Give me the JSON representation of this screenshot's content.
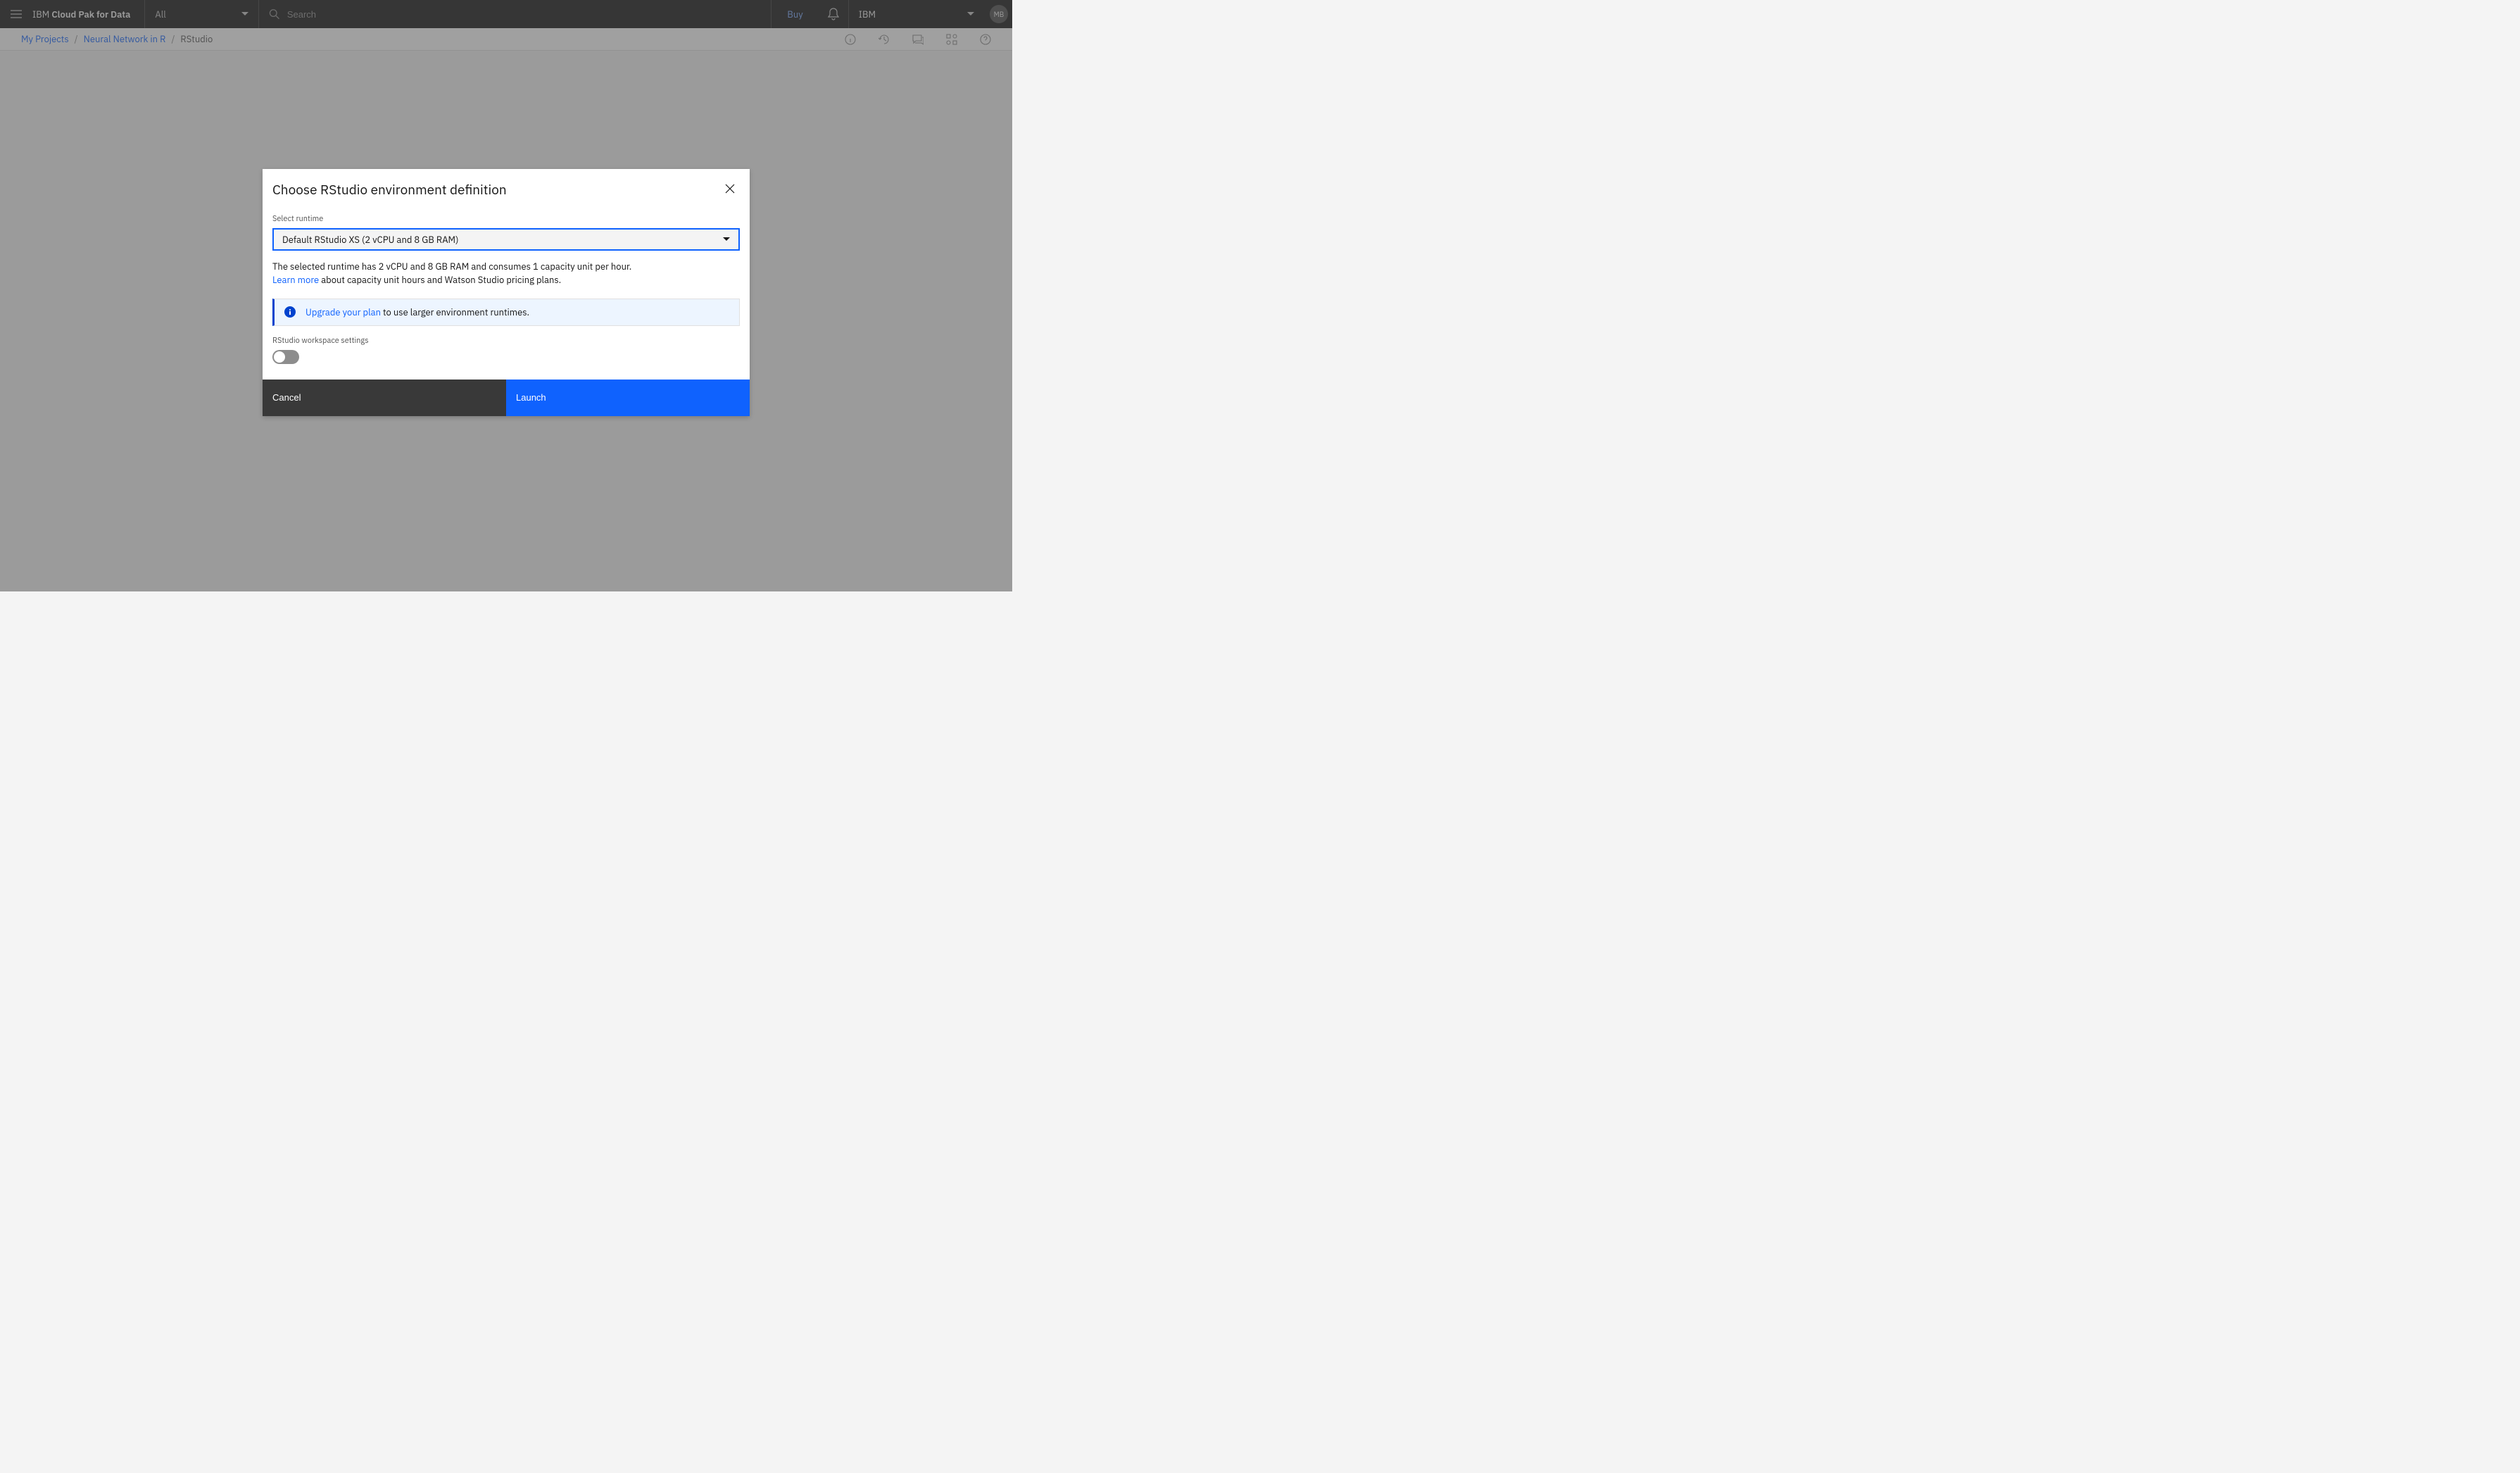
{
  "topbar": {
    "brand_prefix": "IBM ",
    "brand_bold": "Cloud Pak for Data",
    "filter_label": "All",
    "search_placeholder": "Search",
    "buy_label": "Buy",
    "account_label": "IBM",
    "avatar_initials": "MB"
  },
  "breadcrumbs": {
    "items": [
      {
        "label": "My Projects",
        "link": true
      },
      {
        "label": "Neural Network in R",
        "link": true
      },
      {
        "label": "RStudio",
        "link": false
      }
    ],
    "separator": "/"
  },
  "modal": {
    "title": "Choose RStudio environment definition",
    "select_label": "Select runtime",
    "select_value": "Default RStudio XS (2 vCPU and 8 GB RAM)",
    "runtime_desc_line1": "The selected runtime has 2 vCPU and 8 GB RAM and consumes 1 capacity unit per hour.",
    "learn_more": "Learn more",
    "runtime_desc_line2_rest": " about capacity unit hours and Watson Studio pricing plans.",
    "info_link": "Upgrade your plan",
    "info_rest": " to use larger environment runtimes.",
    "workspace_label": "RStudio workspace settings",
    "cancel_label": "Cancel",
    "launch_label": "Launch"
  }
}
